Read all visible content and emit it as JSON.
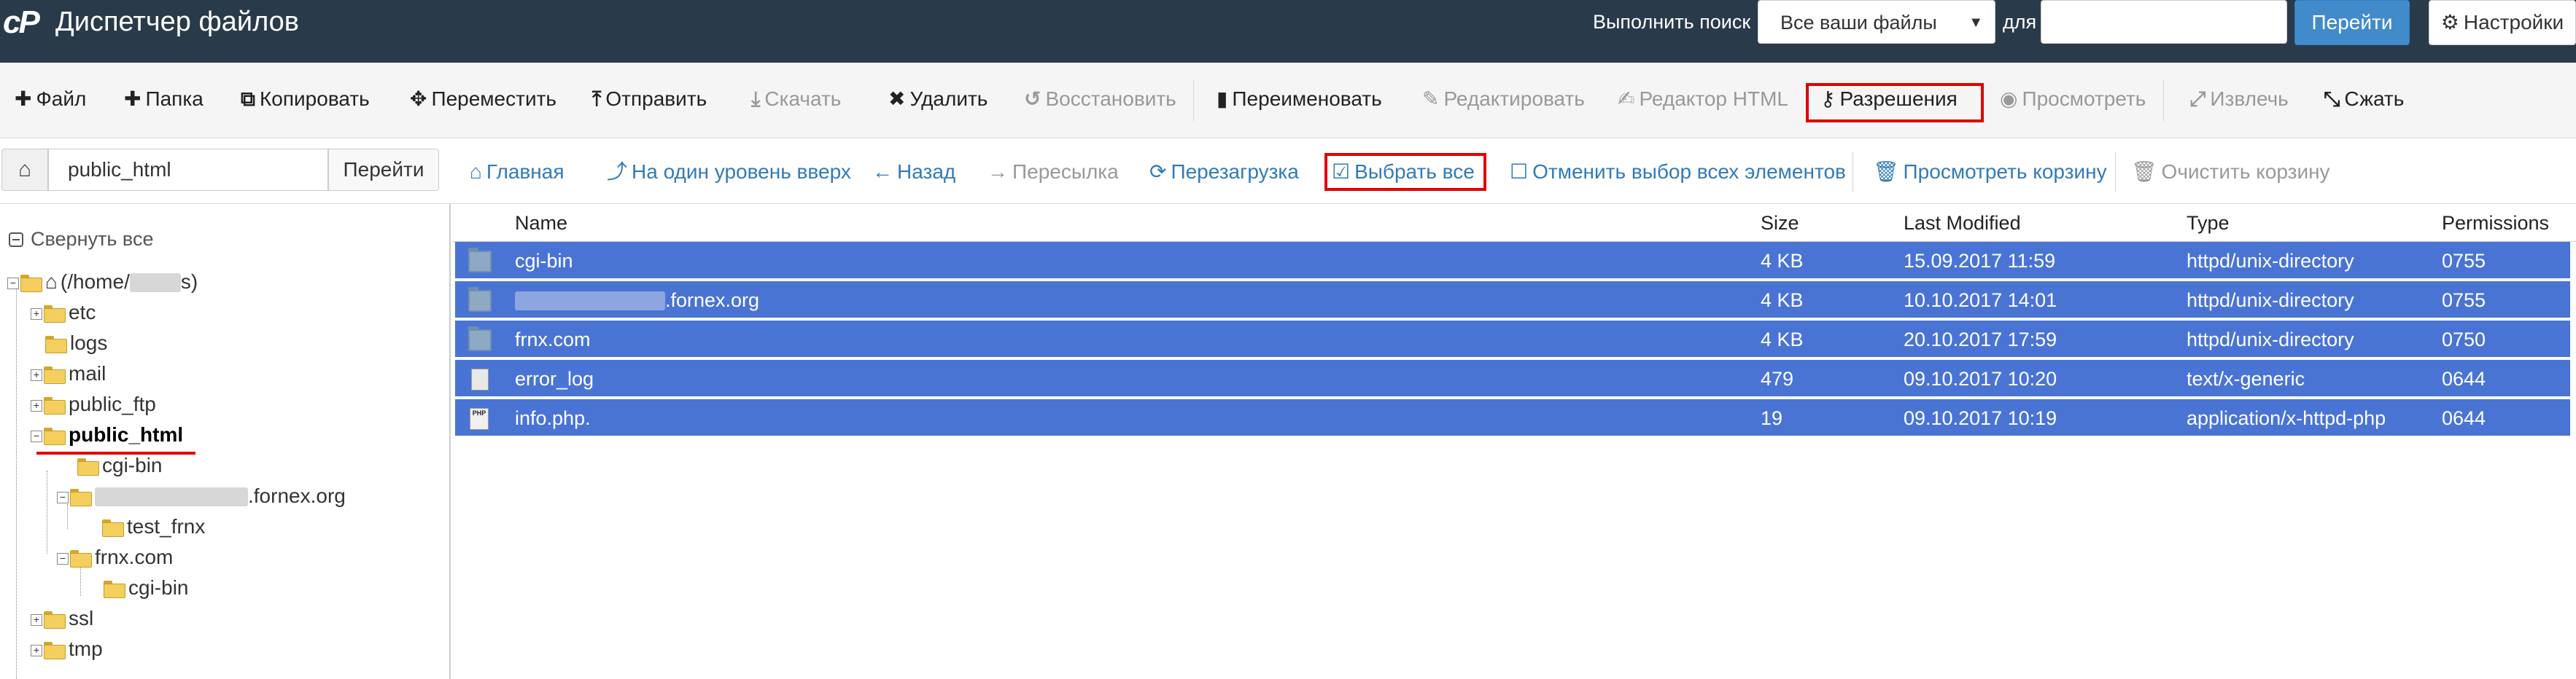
{
  "topbar": {
    "logo_text": "cP",
    "title": "Диспетчер файлов",
    "search_label": "Выполнить поиск",
    "search_scope": "Все ваши файлы",
    "for_label": "для",
    "search_value": "",
    "go_label": "Перейти",
    "settings_label": "Настройки",
    "bg_color": "#293a4a"
  },
  "toolbar": {
    "items": [
      {
        "label": "Файл",
        "icon": "plus-icon",
        "glyph": "✚",
        "enabled": true
      },
      {
        "label": "Папка",
        "icon": "plus-icon",
        "glyph": "✚",
        "enabled": true
      },
      {
        "label": "Копировать",
        "icon": "copy-icon",
        "glyph": "⧉",
        "enabled": true
      },
      {
        "label": "Переместить",
        "icon": "move-icon",
        "glyph": "✥",
        "enabled": true
      },
      {
        "label": "Отправить",
        "icon": "upload-icon",
        "glyph": "⤒",
        "enabled": true
      },
      {
        "label": "Скачать",
        "icon": "download-icon",
        "glyph": "⤓",
        "enabled": false
      },
      {
        "label": "Удалить",
        "icon": "delete-icon",
        "glyph": "✖",
        "enabled": true
      },
      {
        "label": "Восстановить",
        "icon": "restore-icon",
        "glyph": "↺",
        "enabled": false
      },
      {
        "label": "Переименовать",
        "icon": "file-icon",
        "glyph": "▮",
        "enabled": true
      },
      {
        "label": "Редактировать",
        "icon": "pencil-icon",
        "glyph": "✎",
        "enabled": false
      },
      {
        "label": "Редактор HTML",
        "icon": "html-editor-icon",
        "glyph": "✍",
        "enabled": false
      },
      {
        "label": "Разрешения",
        "icon": "key-icon",
        "glyph": "⚷",
        "enabled": true
      },
      {
        "label": "Просмотреть",
        "icon": "eye-icon",
        "glyph": "◉",
        "enabled": false
      },
      {
        "label": "Извлечь",
        "icon": "expand-icon",
        "glyph": "⤢",
        "enabled": false
      },
      {
        "label": "Сжать",
        "icon": "compress-icon",
        "glyph": "⤡",
        "enabled": true
      }
    ]
  },
  "nav": {
    "path_value": "public_html",
    "go_label": "Перейти",
    "items": [
      {
        "label": "Главная",
        "icon": "home-icon",
        "glyph": "⌂",
        "enabled": true
      },
      {
        "label": "На один уровень вверх",
        "icon": "level-up-icon",
        "glyph": "⤴",
        "enabled": true
      },
      {
        "label": "Назад",
        "icon": "arrow-left-icon",
        "glyph": "←",
        "enabled": true
      },
      {
        "label": "Пересылка",
        "icon": "arrow-right-icon",
        "glyph": "→",
        "enabled": false
      },
      {
        "label": "Перезагрузка",
        "icon": "refresh-icon",
        "glyph": "⟳",
        "enabled": true
      },
      {
        "label": "Выбрать все",
        "icon": "checkbox-checked-icon",
        "glyph": "☑",
        "enabled": true
      },
      {
        "label": "Отменить выбор всех элементов",
        "icon": "checkbox-empty-icon",
        "glyph": "☐",
        "enabled": true
      },
      {
        "label": "Просмотреть корзину",
        "icon": "trash-icon",
        "glyph": "🗑",
        "enabled": true
      },
      {
        "label": "Очистить корзину",
        "icon": "trash-icon",
        "glyph": "🗑",
        "enabled": false
      }
    ]
  },
  "tree": {
    "collapse_all": "Свернуть все",
    "root_prefix": "(/home/",
    "root_suffix": "s)",
    "nodes": [
      {
        "label": "etc",
        "toggle": "+"
      },
      {
        "label": "logs",
        "toggle": ""
      },
      {
        "label": "mail",
        "toggle": "+"
      },
      {
        "label": "public_ftp",
        "toggle": "+"
      },
      {
        "label": "public_html",
        "toggle": "−"
      },
      {
        "label": "cgi-bin",
        "toggle": ""
      },
      {
        "label": ".fornex.org",
        "toggle": "−"
      },
      {
        "label": "test_frnx",
        "toggle": ""
      },
      {
        "label": "frnx.com",
        "toggle": "−"
      },
      {
        "label": "cgi-bin",
        "toggle": ""
      },
      {
        "label": "ssl",
        "toggle": "+"
      },
      {
        "label": "tmp",
        "toggle": "+"
      }
    ]
  },
  "table": {
    "headers": [
      "Name",
      "Size",
      "Last Modified",
      "Type",
      "Permissions"
    ],
    "selected_color": "#4a74d4",
    "rows": [
      {
        "name": "cgi-bin",
        "size": "4 KB",
        "modified": "15.09.2017 11:59",
        "type": "httpd/unix-directory",
        "perms": "0755",
        "icon": "folder-icon"
      },
      {
        "name": ".fornex.org",
        "size": "4 KB",
        "modified": "10.10.2017 14:01",
        "type": "httpd/unix-directory",
        "perms": "0755",
        "icon": "folder-icon"
      },
      {
        "name": "frnx.com",
        "size": "4 KB",
        "modified": "20.10.2017 17:59",
        "type": "httpd/unix-directory",
        "perms": "0750",
        "icon": "folder-icon"
      },
      {
        "name": "error_log",
        "size": "479",
        "modified": "09.10.2017 10:20",
        "type": "text/x-generic",
        "perms": "0644",
        "icon": "text-file-icon"
      },
      {
        "name": "info.php.",
        "size": "19",
        "modified": "09.10.2017 10:19",
        "type": "application/x-httpd-php",
        "perms": "0644",
        "icon": "php-file-icon"
      }
    ]
  }
}
